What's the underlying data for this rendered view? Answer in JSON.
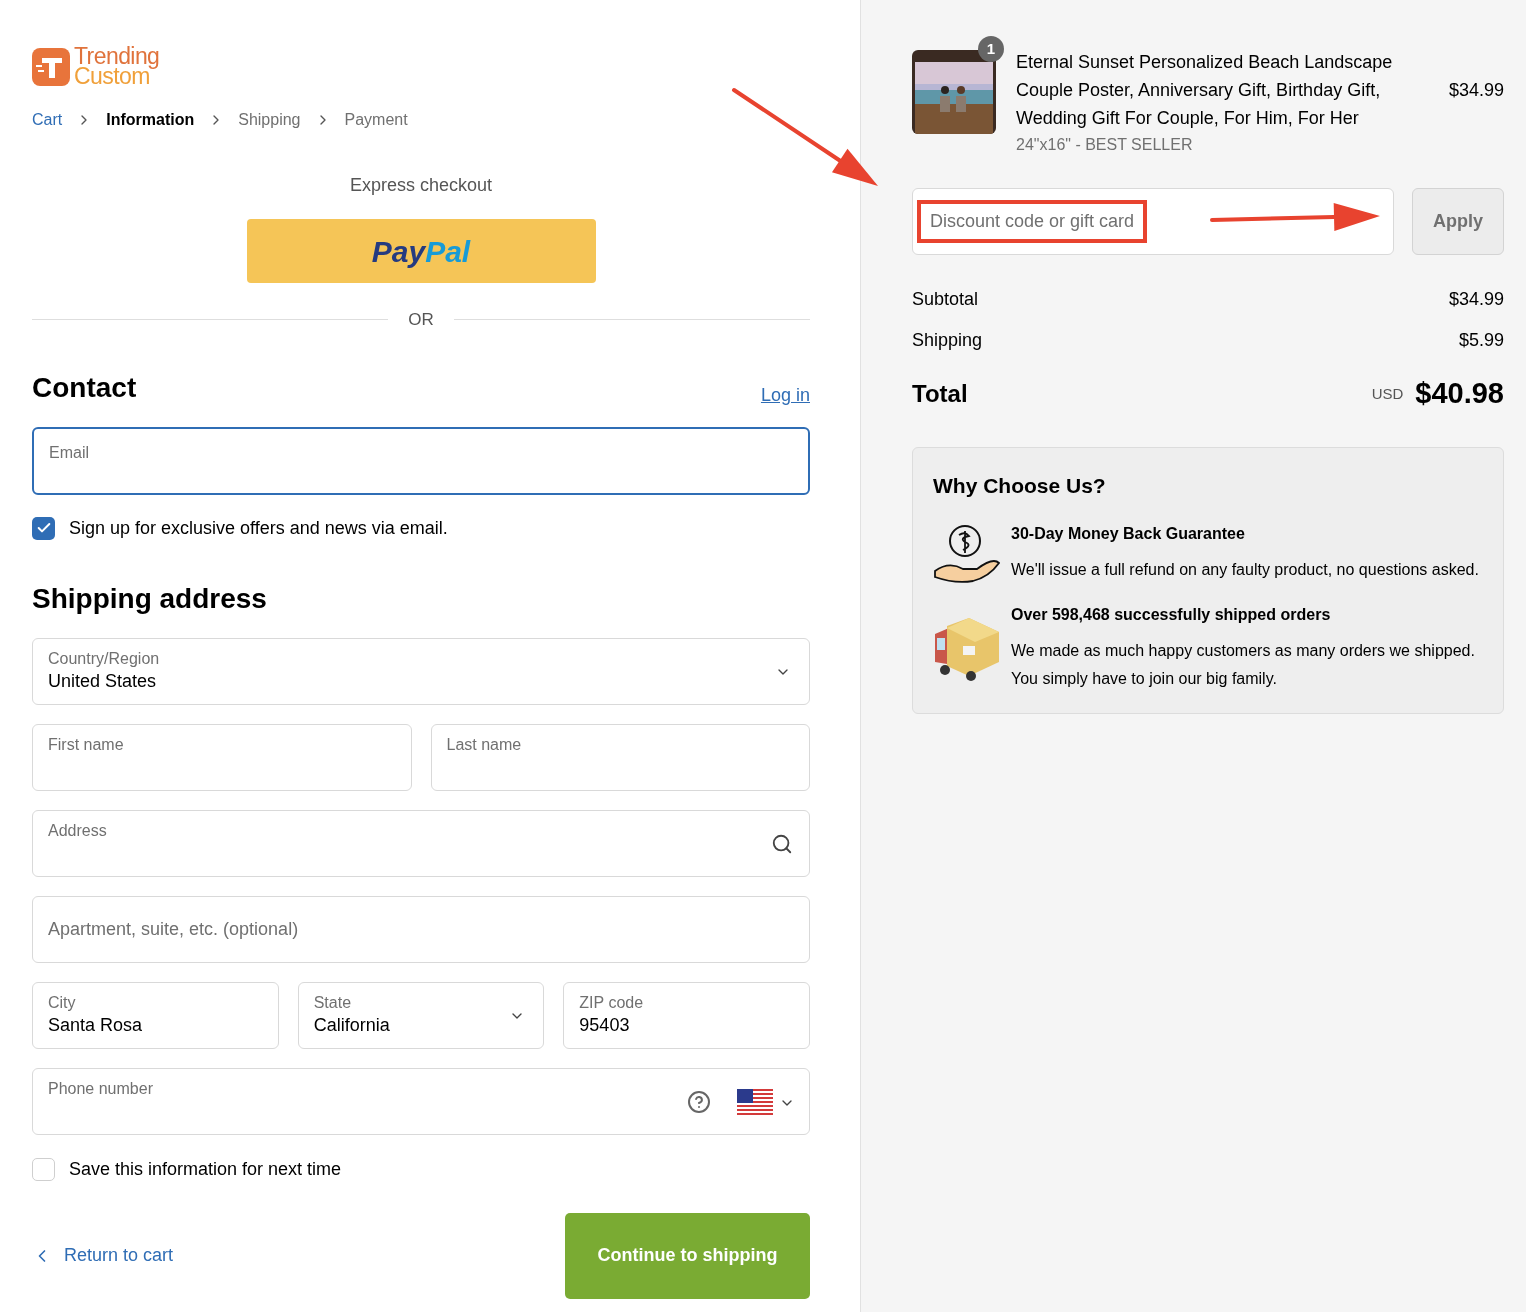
{
  "logo": {
    "line1": "Trending",
    "line2": "Custom"
  },
  "breadcrumbs": [
    {
      "label": "Cart",
      "kind": "link"
    },
    {
      "label": "Information",
      "kind": "current"
    },
    {
      "label": "Shipping",
      "kind": "upcoming"
    },
    {
      "label": "Payment",
      "kind": "upcoming"
    }
  ],
  "express": {
    "title": "Express checkout",
    "paypal": [
      "Pay",
      "Pal"
    ],
    "divider": "OR"
  },
  "contact": {
    "title": "Contact",
    "login": "Log in",
    "email": {
      "label": "Email",
      "focused": true
    },
    "newsletter": {
      "label": "Sign up for exclusive offers and news via email.",
      "checked": true
    }
  },
  "shipping": {
    "title": "Shipping address",
    "rows": [
      [
        {
          "kind": "select",
          "label": "Country/Region",
          "value": "United States"
        }
      ],
      [
        {
          "kind": "text",
          "label": "First name"
        },
        {
          "kind": "text",
          "label": "Last name"
        }
      ],
      [
        {
          "kind": "search",
          "label": "Address"
        }
      ],
      [
        {
          "kind": "placeholder",
          "placeholder": "Apartment, suite, etc. (optional)"
        }
      ],
      [
        {
          "kind": "text",
          "label": "City",
          "value": "Santa Rosa"
        },
        {
          "kind": "select",
          "label": "State",
          "value": "California"
        },
        {
          "kind": "text",
          "label": "ZIP code",
          "value": "95403"
        }
      ],
      [
        {
          "kind": "phone",
          "label": "Phone number"
        }
      ]
    ],
    "save": {
      "label": "Save this information for next time",
      "checked": false
    }
  },
  "footer": {
    "back": "Return to cart",
    "continue": "Continue to shipping"
  },
  "summary": {
    "product": {
      "quantity": "1",
      "title": "Eternal Sunset Personalized Beach Landscape Couple Poster, Anniversary Gift, Birthday Gift, Wedding Gift For Couple, For Him, For Her",
      "variant": "24\"x16\" - BEST SELLER",
      "price": "$34.99"
    },
    "discount": {
      "placeholder": "Discount code or gift card",
      "button": "Apply"
    },
    "lines": [
      {
        "label": "Subtotal",
        "value": "$34.99"
      },
      {
        "label": "Shipping",
        "value": "$5.99"
      }
    ],
    "total": {
      "label": "Total",
      "currency": "USD",
      "value": "$40.98"
    }
  },
  "why": {
    "title": "Why Choose Us?",
    "items": [
      {
        "kind": "money",
        "title": "30-Day Money Back Guarantee",
        "text": "We'll issue a full refund on any faulty product, no questions asked."
      },
      {
        "kind": "truck",
        "title": "Over 598,468 successfully shipped orders",
        "text": "We made as much happy customers as many orders we shipped. You simply have to join our big family."
      }
    ]
  }
}
